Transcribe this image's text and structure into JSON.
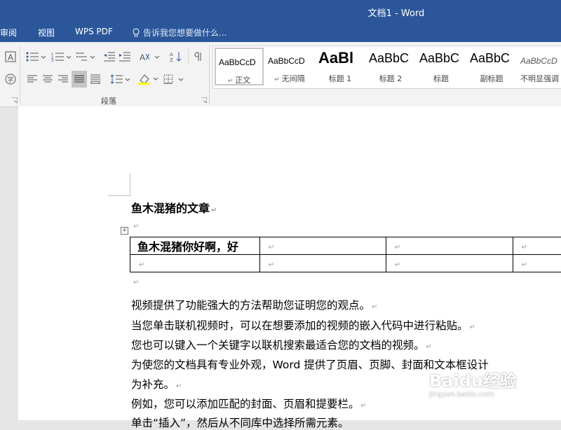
{
  "window": {
    "title": "文档1 - Word"
  },
  "tabs": [
    {
      "label": "审阅"
    },
    {
      "label": "视图"
    },
    {
      "label": "WPS PDF"
    }
  ],
  "tell_me": {
    "placeholder": "告诉我您想要做什么..."
  },
  "ribbon": {
    "paragraph_group_label": "段落",
    "icons": [
      "font-box-A-icon",
      "font-circle-icon",
      "bullets-icon",
      "numbering-icon",
      "multilevel-list-icon",
      "decrease-indent-icon",
      "increase-indent-icon",
      "chinese-layout-icon",
      "sort-icon",
      "show-marks-icon",
      "align-left-icon",
      "align-center-icon",
      "align-right-icon",
      "justify-icon",
      "distributed-icon",
      "line-spacing-icon",
      "shading-icon",
      "borders-icon"
    ]
  },
  "styles": [
    {
      "sample": "AaBbCcD",
      "name": "正文"
    },
    {
      "sample": "AaBbCcD",
      "name": "无间隔"
    },
    {
      "sample": "AaBl",
      "name": "标题 1"
    },
    {
      "sample": "AaBbC",
      "name": "标题 2"
    },
    {
      "sample": "AaBbC",
      "name": "标题"
    },
    {
      "sample": "AaBbC",
      "name": "副标题"
    },
    {
      "sample": "AaBbCcD",
      "name": "不明显强调"
    }
  ],
  "document": {
    "heading": "鱼木混猪的文章",
    "table": [
      [
        "鱼木混猪你好啊，好",
        "",
        "",
        ""
      ],
      [
        "",
        "",
        "",
        ""
      ]
    ],
    "paragraphs": [
      "视频提供了功能强大的方法帮助您证明您的观点。",
      "当您单击联机视频时，可以在想要添加的视频的嵌入代码中进行粘贴。",
      "您也可以键入一个关键字以联机搜索最适合您的文档的视频。",
      "为使您的文档具有专业外观，Word 提供了页眉、页脚、封面和文本框设计",
      "为补充。",
      "例如，您可以添加匹配的封面、页眉和提要栏。",
      "单击“插入”，然后从不同库中选择所需元素。"
    ]
  },
  "watermark": {
    "brand": "Baidu经验",
    "url": "jingyan.baidu.com"
  },
  "colors": {
    "titlebar": "#2b579a",
    "ribbon": "#f3f3f3",
    "page": "#ffffff"
  }
}
